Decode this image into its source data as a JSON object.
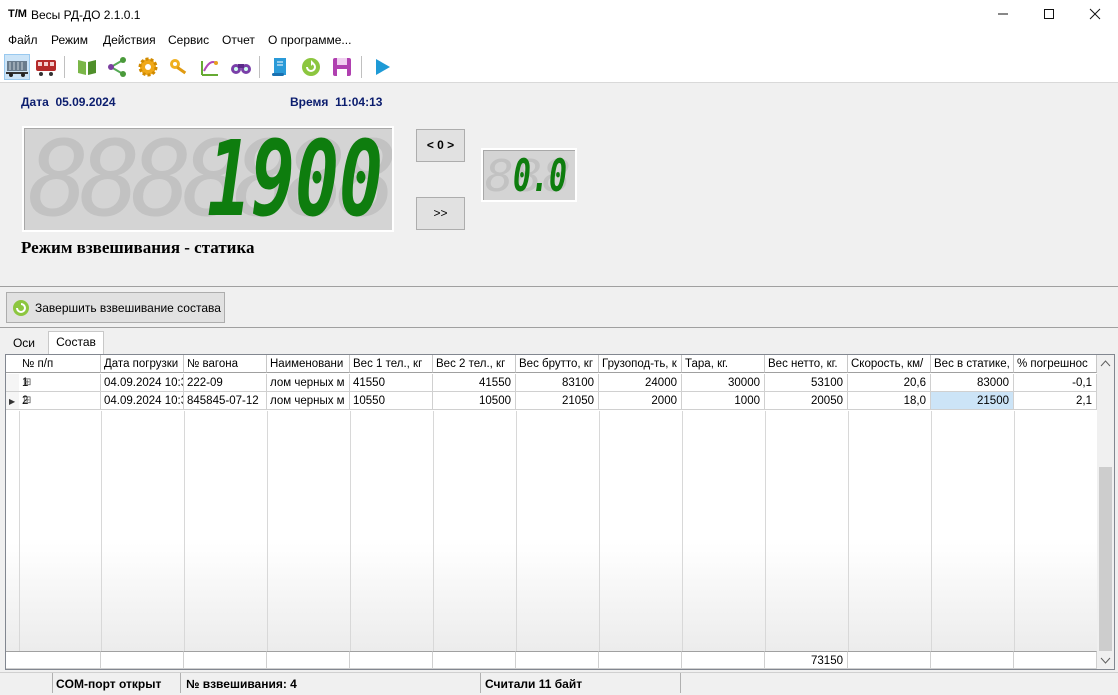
{
  "window": {
    "logo": "T/M",
    "title": "Весы РД-ДО 2.1.0.1",
    "minimize": "—",
    "maximize": "☐",
    "close": "✕"
  },
  "menu": [
    "Файл",
    "Режим",
    "Действия",
    "Сервис",
    "Отчет",
    "О программе..."
  ],
  "toolbar": {
    "icons": [
      "wagon-static-icon",
      "wagon-dynamic-icon",
      "book-icon",
      "share-icon",
      "gear-icon",
      "key-icon",
      "chart-icon",
      "binoculars-icon",
      "script-icon",
      "refresh-icon",
      "save-icon",
      "play-icon"
    ]
  },
  "info": {
    "date_label": "Дата",
    "date_value": "05.09.2024",
    "time_label": "Время",
    "time_value": "11:04:13"
  },
  "display": {
    "main_bg_digits": "8888888",
    "main_value": "1900",
    "small_bg_digits": "888",
    "small_value": "0.0",
    "zero_button": "< 0 >",
    "next_button": ">>"
  },
  "mode": "Режим взвешивания - статика",
  "finish_button": "Завершить взвешивание состава",
  "tabs": [
    "Оси",
    "Состав"
  ],
  "table": {
    "columns": [
      "№ п/п",
      "Дата погрузки",
      "№ вагона",
      "Наименовани",
      "Вес 1 тел., кг",
      "Вес 2 тел., кг",
      "Вес брутто, кг",
      "Грузопод-ть, к",
      "Тара, кг.",
      "Вес нетто, кг.",
      "Скорость, км/",
      "Вес в статике,",
      "% погрешнос"
    ],
    "rows": [
      [
        "1",
        "04.09.2024 10:3",
        "222-09",
        "лом черных м",
        "41550",
        "41550",
        "83100",
        "24000",
        "30000",
        "53100",
        "20,6",
        "83000",
        "-0,1"
      ],
      [
        "2",
        "04.09.2024 10:3",
        "845845-07-12",
        "лом черных м",
        "10550",
        "10500",
        "21050",
        "2000",
        "1000",
        "20050",
        "18,0",
        "21500",
        "2,1"
      ]
    ],
    "totals": [
      "",
      "",
      "",
      "",
      "",
      "",
      "",
      "",
      "",
      "73150",
      "",
      "",
      ""
    ],
    "expand_glyph": "⊞",
    "current_row_glyph": "▶"
  },
  "status": {
    "port": "COM-порт открыт",
    "weighing": "№ взвешивания: 4",
    "bytes": "Считали 11 байт"
  }
}
